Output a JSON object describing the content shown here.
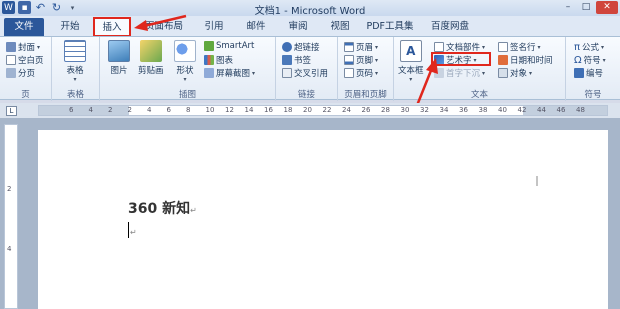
{
  "window": {
    "title": "文档1 - Microsoft Word",
    "controls": [
      "–",
      "□",
      "✕"
    ]
  },
  "tabs": [
    {
      "label": "文件"
    },
    {
      "label": "开始"
    },
    {
      "label": "插入"
    },
    {
      "label": "页面布局"
    },
    {
      "label": "引用"
    },
    {
      "label": "邮件"
    },
    {
      "label": "审阅"
    },
    {
      "label": "视图"
    },
    {
      "label": "PDF工具集"
    },
    {
      "label": "百度网盘"
    }
  ],
  "ribbon": {
    "pages": {
      "label": "页",
      "items": [
        "封面",
        "空白页",
        "分页"
      ]
    },
    "tables": {
      "label": "表格",
      "items": [
        "表格"
      ]
    },
    "illustrations": {
      "label": "插图",
      "items": [
        "图片",
        "剪贴画",
        "形状",
        "SmartArt",
        "图表",
        "屏幕截图"
      ]
    },
    "links": {
      "label": "链接",
      "items": [
        "超链接",
        "书签",
        "交叉引用"
      ]
    },
    "header_footer": {
      "label": "页眉和页脚",
      "items": [
        "页眉",
        "页脚",
        "页码"
      ]
    },
    "text": {
      "label": "文本",
      "items": [
        "文本框",
        "文档部件",
        "艺术字",
        "首字下沉",
        "签名行",
        "日期和时间",
        "对象"
      ]
    },
    "symbols": {
      "label": "符号",
      "items": [
        "公式",
        "符号",
        "编号"
      ]
    }
  },
  "ruler": {
    "ticks": [
      "6",
      "4",
      "2",
      "2",
      "4",
      "6",
      "8",
      "10",
      "12",
      "14",
      "16",
      "18",
      "20",
      "22",
      "24",
      "26",
      "28",
      "30",
      "32",
      "34",
      "36",
      "38",
      "40",
      "42",
      "44",
      "46",
      "48"
    ],
    "vticks": [
      "2",
      "4"
    ]
  },
  "document": {
    "line1": "360 新知",
    "pilcrow": "↵"
  },
  "colors": {
    "file_tab": "#2b579a",
    "highlight": "#e0271d",
    "ribbon_bg": "#f8fbff"
  }
}
